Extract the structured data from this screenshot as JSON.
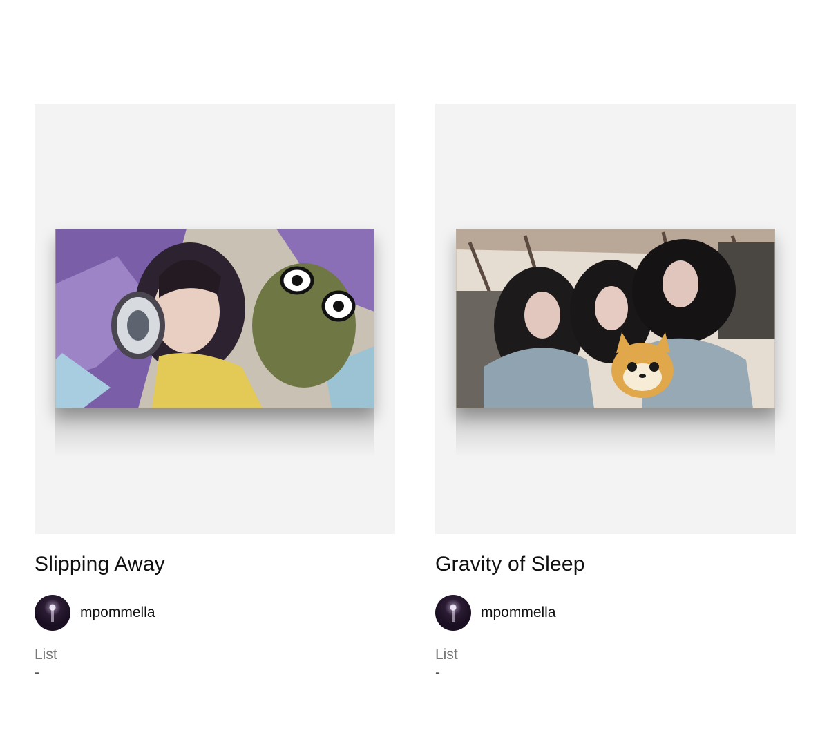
{
  "cards": [
    {
      "title": "Slipping Away",
      "creator": "mpommella",
      "list_label": "List",
      "list_value": "-",
      "artwork": "digital-painting-girl-headphones-frog"
    },
    {
      "title": "Gravity of Sleep",
      "creator": "mpommella",
      "list_label": "List",
      "list_value": "-",
      "artwork": "digital-painting-three-sleeping-girls-shiba"
    }
  ],
  "colors": {
    "preview_bg": "#f3f3f3",
    "title": "#111111",
    "label": "#777777"
  }
}
